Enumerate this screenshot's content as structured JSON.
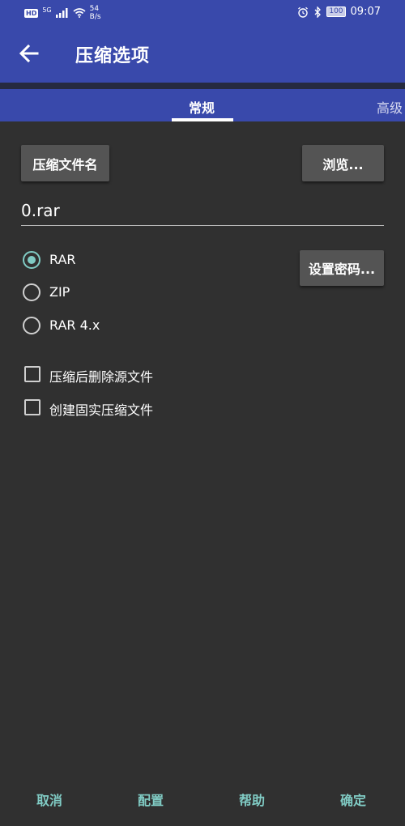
{
  "status_bar": {
    "network_badge": "HD",
    "signal": "5G",
    "speed_value": "54",
    "speed_unit": "B/s",
    "battery": "100",
    "time": "09:07"
  },
  "app_bar": {
    "title": "压缩选项"
  },
  "tabs": [
    {
      "label": "常规",
      "selected": true
    },
    {
      "label": "高级",
      "selected": false
    }
  ],
  "archive_name_button": "压缩文件名",
  "browse_button": "浏览...",
  "archive_name_value": "0.rar",
  "set_password_button": "设置密码...",
  "formats": [
    {
      "label": "RAR",
      "checked": true
    },
    {
      "label": "ZIP",
      "checked": false
    },
    {
      "label": "RAR 4.x",
      "checked": false
    }
  ],
  "options": [
    {
      "label": "压缩后删除源文件",
      "checked": false
    },
    {
      "label": "创建固实压缩文件",
      "checked": false
    }
  ],
  "footer": {
    "cancel": "取消",
    "profiles": "配置",
    "help": "帮助",
    "ok": "确定"
  },
  "colors": {
    "primary": "#3949ab",
    "accent": "#80cbc4",
    "background": "#303030",
    "button": "#545454"
  }
}
